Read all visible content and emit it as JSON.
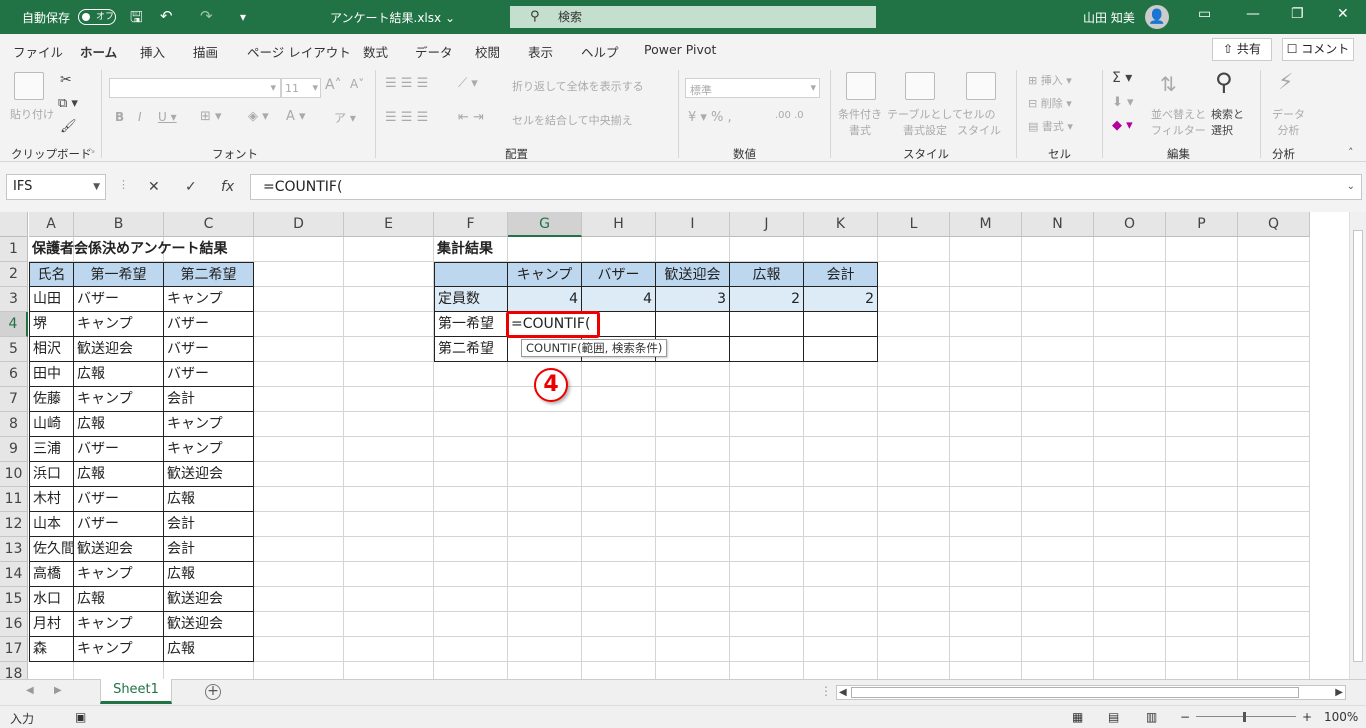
{
  "titlebar": {
    "autosave": "自動保存",
    "toggle": "オフ",
    "title": "アンケート結果.xlsx  ⌄",
    "search": "検索",
    "user": "山田 知美"
  },
  "menu": {
    "items": [
      "ファイル",
      "ホーム",
      "挿入",
      "描画",
      "ページ レイアウト",
      "数式",
      "データ",
      "校閲",
      "表示",
      "ヘルプ",
      "Power Pivot"
    ],
    "share": "共有",
    "comment": "コメント"
  },
  "ribbon": {
    "groups": [
      "クリップボード",
      "フォント",
      "配置",
      "数値",
      "スタイル",
      "セル",
      "編集",
      "分析"
    ],
    "paste": "貼り付け",
    "font_size": "11",
    "wrap": "折り返して全体を表示する",
    "merge": "セルを結合して中央揃え",
    "number_format": "標準",
    "cond_format": "条件付き\n書式",
    "table_format": "テーブルとして\n書式設定",
    "cell_style": "セルの\nスタイル",
    "insert": "挿入",
    "delete": "削除",
    "format": "書式",
    "sort": "並べ替えと\nフィルター",
    "find": "検索と\n選択",
    "analyze": "データ\n分析"
  },
  "formula": {
    "namebox": "IFS",
    "content": "=COUNTIF("
  },
  "columns": [
    "A",
    "B",
    "C",
    "D",
    "E",
    "F",
    "G",
    "H",
    "I",
    "J",
    "K",
    "L",
    "M",
    "N",
    "O",
    "P",
    "Q"
  ],
  "rows": [
    "1",
    "2",
    "3",
    "4",
    "5",
    "6",
    "7",
    "8",
    "9",
    "10",
    "11",
    "12",
    "13",
    "14",
    "15",
    "16",
    "17",
    "18"
  ],
  "survey": {
    "title": "保護者会係決めアンケート結果",
    "headers": [
      "氏名",
      "第一希望",
      "第二希望"
    ],
    "data": [
      [
        "山田",
        "バザー",
        "キャンプ"
      ],
      [
        "堺",
        "キャンプ",
        "バザー"
      ],
      [
        "相沢",
        "歓送迎会",
        "バザー"
      ],
      [
        "田中",
        "広報",
        "バザー"
      ],
      [
        "佐藤",
        "キャンプ",
        "会計"
      ],
      [
        "山崎",
        "広報",
        "キャンプ"
      ],
      [
        "三浦",
        "バザー",
        "キャンプ"
      ],
      [
        "浜口",
        "広報",
        "歓送迎会"
      ],
      [
        "木村",
        "バザー",
        "広報"
      ],
      [
        "山本",
        "バザー",
        "会計"
      ],
      [
        "佐久間",
        "歓送迎会",
        "会計"
      ],
      [
        "高橋",
        "キャンプ",
        "広報"
      ],
      [
        "水口",
        "広報",
        "歓送迎会"
      ],
      [
        "月村",
        "キャンプ",
        "歓送迎会"
      ],
      [
        "森",
        "キャンプ",
        "広報"
      ]
    ]
  },
  "summary": {
    "title": "集計結果",
    "headers": [
      "",
      "キャンプ",
      "バザー",
      "歓送迎会",
      "広報",
      "会計"
    ],
    "rows": [
      {
        "label": "定員数",
        "values": [
          "4",
          "4",
          "3",
          "2",
          "2"
        ]
      },
      {
        "label": "第一希望",
        "values": [
          "",
          "",
          "",
          "",
          ""
        ]
      },
      {
        "label": "第二希望",
        "values": [
          "",
          "",
          "",
          "",
          ""
        ]
      }
    ],
    "editing": "=COUNTIF(",
    "tooltip": "COUNTIF(範囲, 検索条件)"
  },
  "callout": "4",
  "sheet": {
    "tab": "Sheet1"
  },
  "status": {
    "mode": "入力",
    "zoom": "100%"
  }
}
